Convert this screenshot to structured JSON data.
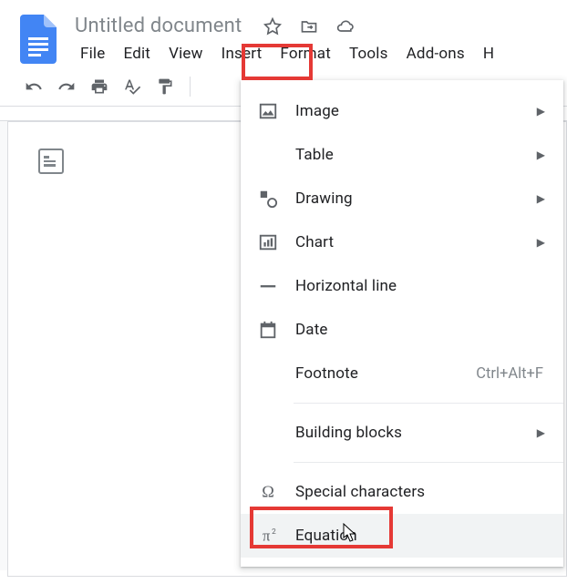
{
  "header": {
    "title": "Untitled document"
  },
  "menu": {
    "file": "File",
    "edit": "Edit",
    "view": "View",
    "insert": "Insert",
    "format": "Format",
    "tools": "Tools",
    "addons": "Add-ons",
    "help": "H"
  },
  "dropdown": {
    "image": "Image",
    "table": "Table",
    "drawing": "Drawing",
    "chart": "Chart",
    "hline": "Horizontal line",
    "date": "Date",
    "footnote": "Footnote",
    "footnote_shortcut": "Ctrl+Alt+F",
    "building": "Building blocks",
    "special": "Special characters",
    "equation": "Equation"
  }
}
